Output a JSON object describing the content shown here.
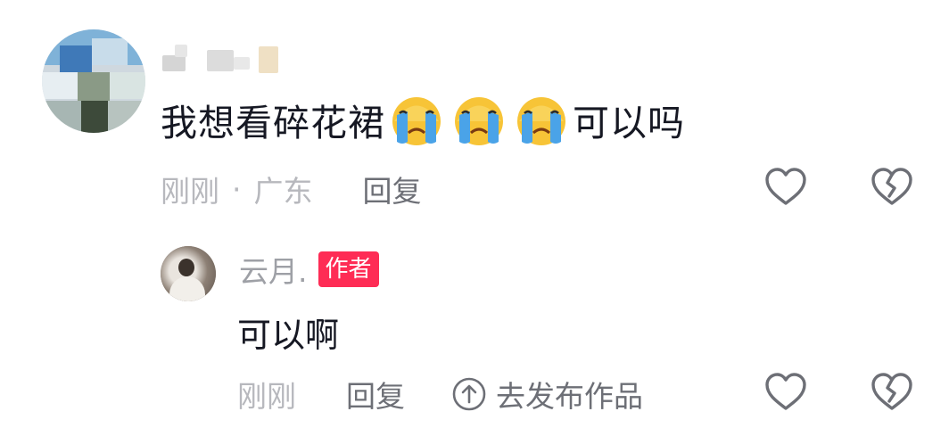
{
  "comment": {
    "text_before": "我想看碎花裙",
    "text_after": "可以吗",
    "emoji_name": "crying-face-emoji",
    "emoji_count": 3,
    "time": "刚刚",
    "separator": "·",
    "location": "广东",
    "reply_label": "回复"
  },
  "reply": {
    "username": "云月.",
    "badge": "作者",
    "text": "可以啊",
    "time": "刚刚",
    "reply_label": "回复",
    "publish_label": "去发布作品"
  },
  "icons": {
    "like": "heart-outline-icon",
    "dislike": "broken-heart-outline-icon",
    "publish": "arrow-up-circle-icon"
  },
  "colors": {
    "text_primary": "#161823",
    "text_secondary": "#b7b8bd",
    "text_action": "#6d6f76",
    "badge": "#fe2c55"
  }
}
